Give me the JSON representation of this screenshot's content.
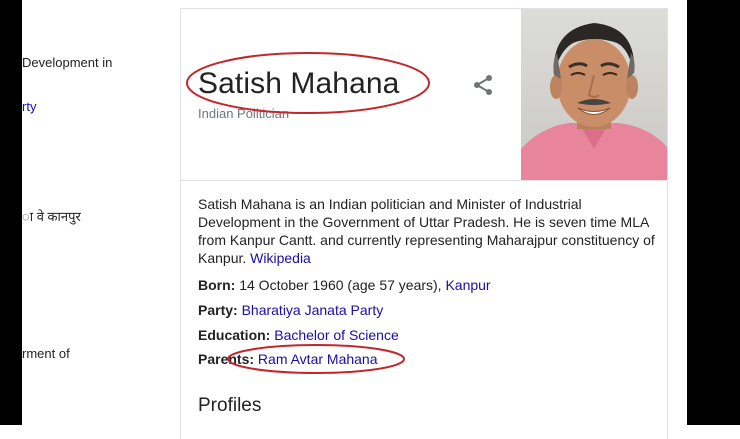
{
  "left_fragments": {
    "line1": "Development in",
    "line2": "rty",
    "line3": "ा वे कानपुर",
    "line4": "rment of"
  },
  "panel": {
    "title": "Satish Mahana",
    "subtitle": "Indian Politician",
    "share_icon": "share-icon",
    "description": "Satish Mahana is an Indian politician and Minister of Industrial Development in the Government of Uttar Pradesh. He is seven time MLA from Kanpur Cantt. and currently representing Maharajpur constituency of Kanpur.",
    "description_link": "Wikipedia",
    "facts": {
      "born_label": "Born:",
      "born_value": "14 October 1960 (age 57 years),",
      "born_link": "Kanpur",
      "party_label": "Party:",
      "party_link": "Bharatiya Janata Party",
      "education_label": "Education:",
      "education_link": "Bachelor of Science",
      "parents_label": "Parents:",
      "parents_link": "Ram Avtar Mahana"
    },
    "profiles_heading": "Profiles"
  },
  "colors": {
    "annotation": "#c0282d",
    "link": "#1a0dab",
    "muted": "#70757a"
  }
}
